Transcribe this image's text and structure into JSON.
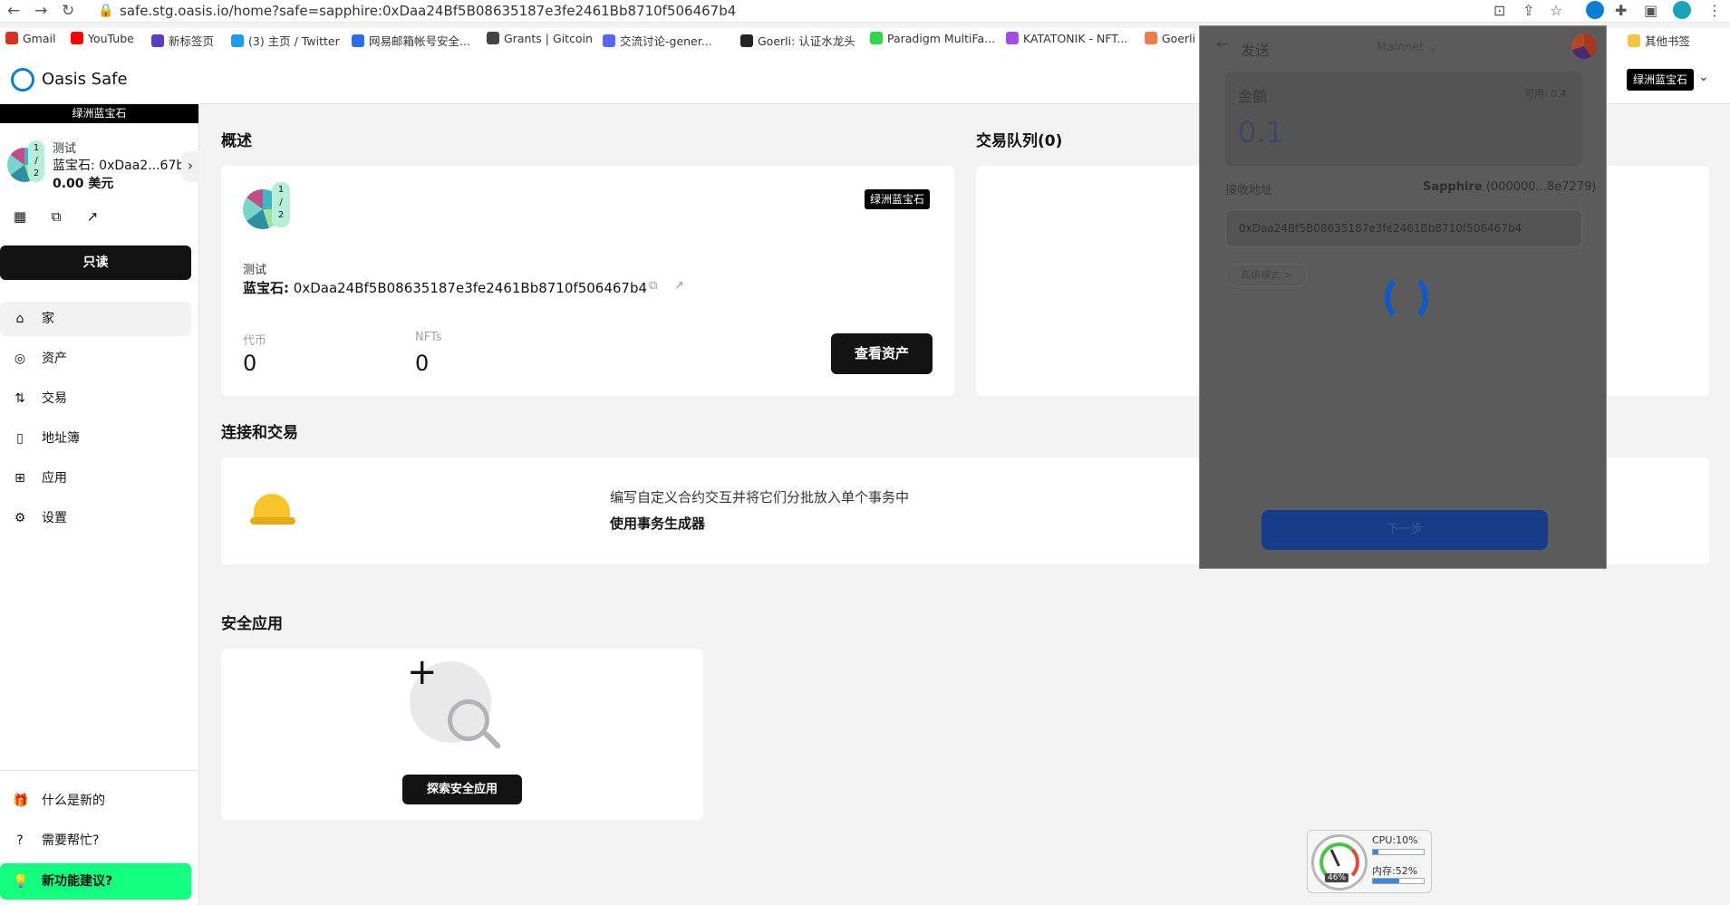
{
  "browser": {
    "url": "safe.stg.oasis.io/home?safe=sapphire:0xDaa24Bf5B08635187e3fe2461Bb8710f506467b4",
    "bookmarks": [
      {
        "label": "Gmail",
        "color": "#d93025"
      },
      {
        "label": "YouTube",
        "color": "#ff0000"
      },
      {
        "label": "新标签页",
        "color": "#5b3cc4"
      },
      {
        "label": "(3) 主页 / Twitter",
        "color": "#1d9bf0"
      },
      {
        "label": "网易邮箱帐号安全...",
        "color": "#2b6de4"
      },
      {
        "label": "Grants | Gitcoin",
        "color": "#444444"
      },
      {
        "label": "交流讨论-gener...",
        "color": "#5865f2"
      },
      {
        "label": "Goerli: 认证水龙头",
        "color": "#222222"
      },
      {
        "label": "Paradigm MultiFa...",
        "color": "#2bd84a"
      },
      {
        "label": "KATATONIK - NFT...",
        "color": "#a54ce8"
      },
      {
        "label": "Goerli",
        "color": "#f07c4a"
      }
    ],
    "other_bookmarks": "其他书签"
  },
  "header": {
    "app_name": "Oasis Safe",
    "chain_badge": "绿洲蓝宝石"
  },
  "sidebar": {
    "chain_label": "绿洲蓝宝石",
    "threshold": {
      "num": "1",
      "sep": "/",
      "den": "2"
    },
    "safe_name": "测试",
    "safe_address": "蓝宝石: 0xDaa2...67b4",
    "balance": "0.00 美元",
    "readonly_label": "只读",
    "nav": [
      {
        "label": "家",
        "icon": "home-icon",
        "glyph": "⌂"
      },
      {
        "label": "资产",
        "icon": "assets-icon",
        "glyph": "◎"
      },
      {
        "label": "交易",
        "icon": "transactions-icon",
        "glyph": "⇅"
      },
      {
        "label": "地址簿",
        "icon": "address-book-icon",
        "glyph": "▯"
      },
      {
        "label": "应用",
        "icon": "apps-icon",
        "glyph": "⊞"
      },
      {
        "label": "设置",
        "icon": "settings-icon",
        "glyph": "⚙"
      }
    ],
    "whats_new": "什么是新的",
    "need_help": "需要帮忙?",
    "feature_request": "新功能建议?"
  },
  "overview": {
    "title": "概述",
    "chain_badge": "绿洲蓝宝石",
    "safe_name": "测试",
    "address_prefix": "蓝宝石:",
    "address": "0xDaa24Bf5B08635187e3fe2461Bb8710f506467b4",
    "tokens_label": "代币",
    "tokens_value": "0",
    "nfts_label": "NFTs",
    "nfts_value": "0",
    "view_assets": "查看资产"
  },
  "queue": {
    "title": "交易队列(0)"
  },
  "connect": {
    "title": "连接和交易",
    "description": "编写自定义合约交互并将它们分批放入单个事务中",
    "link": "使用事务生成器"
  },
  "safe_apps": {
    "title": "安全应用",
    "explore": "探索安全应用"
  },
  "popup": {
    "title": "发送",
    "network": "Mainnet",
    "amount_label": "金额",
    "available": "可用: 0.4",
    "amount": "0.1",
    "recipient_label": "接收地址",
    "recipient_chain": "Sapphire",
    "recipient_short": "(000000...8e7279)",
    "recipient_address": "0xDaa24Bf5B08635187e3fe2461Bb8710f506467b4",
    "advanced": "高级模式 >",
    "next": "下一步"
  },
  "widget": {
    "cpu": "CPU:10%",
    "cpu_level": 0.1,
    "mem": "内存:52%",
    "mem_level": 0.52,
    "gauge": "46%"
  },
  "colors": {
    "accent_green": "#12ff80",
    "oasis_blue": "#0b7dd6",
    "popup_button": "#173d8a"
  }
}
